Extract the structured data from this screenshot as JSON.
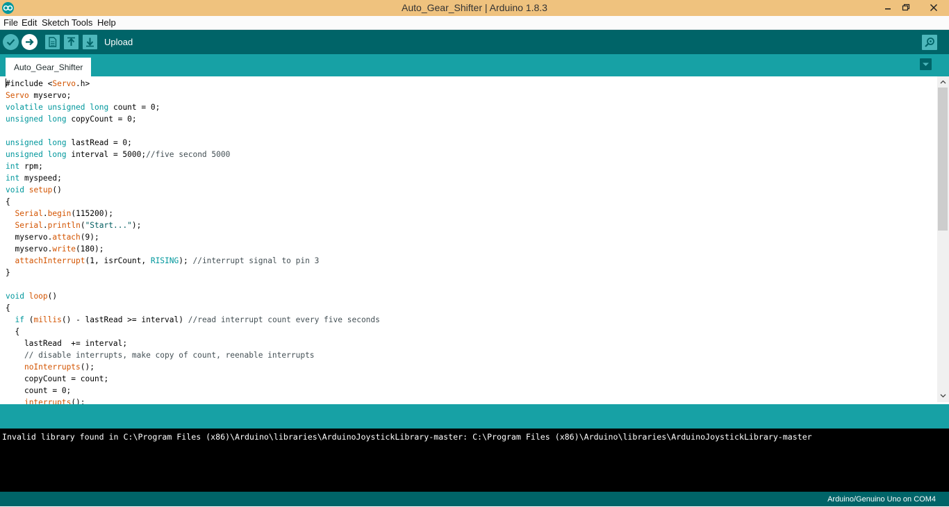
{
  "window": {
    "title": "Auto_Gear_Shifter | Arduino 1.8.3"
  },
  "menu": [
    "File",
    "Edit",
    "Sketch",
    "Tools",
    "Help"
  ],
  "toolbar": {
    "hover_label": "Upload"
  },
  "tabs": [
    {
      "label": "Auto_Gear_Shifter"
    }
  ],
  "editor": {
    "lines": [
      [
        [
          "pl",
          "#include <"
        ],
        [
          "fn",
          "Servo"
        ],
        [
          "pl",
          ".h>"
        ]
      ],
      [
        [
          "fn",
          "Servo"
        ],
        [
          "pl",
          " myservo;"
        ]
      ],
      [
        [
          "kw",
          "volatile"
        ],
        [
          "pl",
          " "
        ],
        [
          "kw",
          "unsigned"
        ],
        [
          "pl",
          " "
        ],
        [
          "kw",
          "long"
        ],
        [
          "pl",
          " count = 0;"
        ]
      ],
      [
        [
          "kw",
          "unsigned"
        ],
        [
          "pl",
          " "
        ],
        [
          "kw",
          "long"
        ],
        [
          "pl",
          " copyCount = 0;"
        ]
      ],
      [],
      [
        [
          "kw",
          "unsigned"
        ],
        [
          "pl",
          " "
        ],
        [
          "kw",
          "long"
        ],
        [
          "pl",
          " lastRead = 0;"
        ]
      ],
      [
        [
          "kw",
          "unsigned"
        ],
        [
          "pl",
          " "
        ],
        [
          "kw",
          "long"
        ],
        [
          "pl",
          " interval = 5000;"
        ],
        [
          "cm",
          "//five second 5000"
        ]
      ],
      [
        [
          "kw",
          "int"
        ],
        [
          "pl",
          " rpm;"
        ]
      ],
      [
        [
          "kw",
          "int"
        ],
        [
          "pl",
          " myspeed;"
        ]
      ],
      [
        [
          "kw",
          "void"
        ],
        [
          "pl",
          " "
        ],
        [
          "fn",
          "setup"
        ],
        [
          "pl",
          "()"
        ]
      ],
      [
        [
          "pl",
          "{"
        ]
      ],
      [
        [
          "pl",
          "  "
        ],
        [
          "fn",
          "Serial"
        ],
        [
          "pl",
          "."
        ],
        [
          "fn",
          "begin"
        ],
        [
          "pl",
          "(115200);"
        ]
      ],
      [
        [
          "pl",
          "  "
        ],
        [
          "fn",
          "Serial"
        ],
        [
          "pl",
          "."
        ],
        [
          "fn",
          "println"
        ],
        [
          "pl",
          "("
        ],
        [
          "str",
          "\"Start...\""
        ],
        [
          "pl",
          ");"
        ]
      ],
      [
        [
          "pl",
          "  myservo."
        ],
        [
          "fn",
          "attach"
        ],
        [
          "pl",
          "(9);"
        ]
      ],
      [
        [
          "pl",
          "  myservo."
        ],
        [
          "fn",
          "write"
        ],
        [
          "pl",
          "(180);"
        ]
      ],
      [
        [
          "pl",
          "  "
        ],
        [
          "fn",
          "attachInterrupt"
        ],
        [
          "pl",
          "(1, isrCount, "
        ],
        [
          "kw",
          "RISING"
        ],
        [
          "pl",
          "); "
        ],
        [
          "cm",
          "//interrupt signal to pin 3"
        ]
      ],
      [
        [
          "pl",
          "}"
        ]
      ],
      [],
      [
        [
          "kw",
          "void"
        ],
        [
          "pl",
          " "
        ],
        [
          "fn",
          "loop"
        ],
        [
          "pl",
          "()"
        ]
      ],
      [
        [
          "pl",
          "{"
        ]
      ],
      [
        [
          "pl",
          "  "
        ],
        [
          "kw",
          "if"
        ],
        [
          "pl",
          " ("
        ],
        [
          "fn",
          "millis"
        ],
        [
          "pl",
          "() - lastRead >= interval) "
        ],
        [
          "cm",
          "//read interrupt count every five seconds"
        ]
      ],
      [
        [
          "pl",
          "  {"
        ]
      ],
      [
        [
          "pl",
          "    lastRead  += interval;"
        ]
      ],
      [
        [
          "cm",
          "    // disable interrupts, make copy of count, reenable interrupts"
        ]
      ],
      [
        [
          "pl",
          "    "
        ],
        [
          "fn",
          "noInterrupts"
        ],
        [
          "pl",
          "();"
        ]
      ],
      [
        [
          "pl",
          "    copyCount = count;"
        ]
      ],
      [
        [
          "pl",
          "    count = 0;"
        ]
      ],
      [
        [
          "pl",
          "    "
        ],
        [
          "fn",
          "interrupts"
        ],
        [
          "pl",
          "();"
        ]
      ]
    ]
  },
  "console": {
    "text": "Invalid library found in C:\\Program Files (x86)\\Arduino\\libraries\\ArduinoJoystickLibrary-master: C:\\Program Files (x86)\\Arduino\\libraries\\ArduinoJoystickLibrary-master"
  },
  "status": {
    "board": "Arduino/Genuino Uno on COM4"
  },
  "icons": {
    "verify": "checkmark-icon",
    "upload": "arrow-right-icon",
    "new": "new-file-icon",
    "open": "arrow-up-icon",
    "save": "arrow-down-icon",
    "serial_monitor": "magnifier-icon",
    "tab_menu": "triangle-down-icon"
  },
  "colors": {
    "titlebar": "#efc27e",
    "toolbar": "#006468",
    "tabbar": "#17a1a5",
    "button": "#4db7bb",
    "keyword": "#00979c",
    "function": "#d35400",
    "comment": "#434f54",
    "console_bg": "#000000"
  }
}
